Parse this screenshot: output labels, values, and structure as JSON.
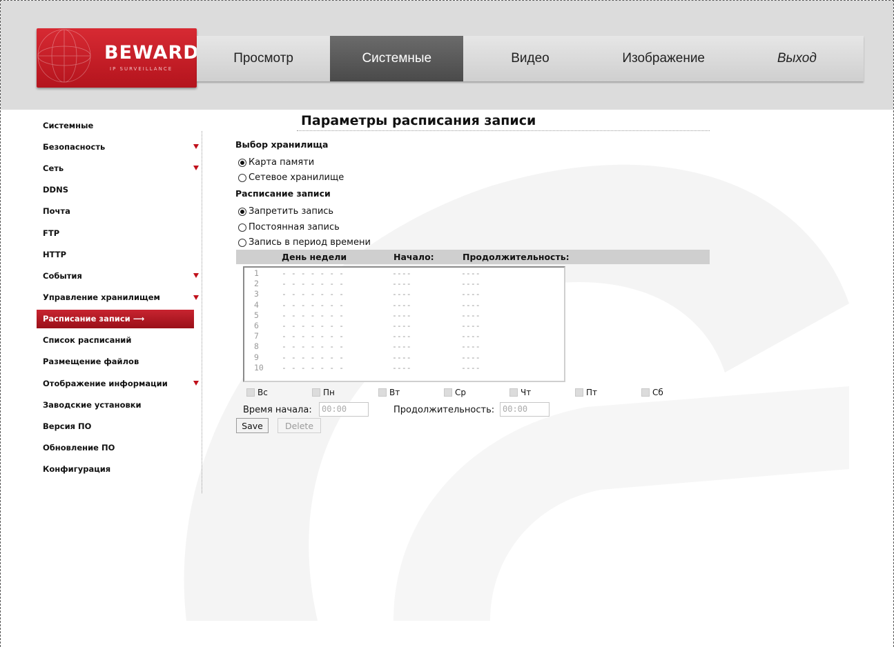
{
  "logo": {
    "text": "BEWARD",
    "sub": "IP SURVEILLANCE"
  },
  "topnav": [
    {
      "label": "Просмотр",
      "active": false
    },
    {
      "label": "Системные",
      "active": true
    },
    {
      "label": "Видео",
      "active": false
    },
    {
      "label": "Изображение",
      "active": false
    },
    {
      "label": "Выход",
      "active": false
    }
  ],
  "sidebar": [
    {
      "label": "Системные",
      "arrow": false
    },
    {
      "label": "Безопасность",
      "arrow": true
    },
    {
      "label": "Сеть",
      "arrow": true
    },
    {
      "label": "DDNS",
      "arrow": false
    },
    {
      "label": "Почта",
      "arrow": false
    },
    {
      "label": "FTP",
      "arrow": false
    },
    {
      "label": "HTTP",
      "arrow": false
    },
    {
      "label": "События",
      "arrow": true
    },
    {
      "label": "Управление хранилищем",
      "arrow": true
    },
    {
      "label": "Расписание записи ⟶",
      "arrow": false,
      "active": true
    },
    {
      "label": "Список расписаний",
      "arrow": false
    },
    {
      "label": "Размещение файлов",
      "arrow": false
    },
    {
      "label": "Отображение информации",
      "arrow": true
    },
    {
      "label": "Заводские установки",
      "arrow": false
    },
    {
      "label": "Версия ПО",
      "arrow": false
    },
    {
      "label": "Обновление ПО",
      "arrow": false
    },
    {
      "label": "Конфигурация",
      "arrow": false
    }
  ],
  "page": {
    "title": "Параметры расписания записи",
    "storage_heading": "Выбор хранилища",
    "storage_options": [
      {
        "label": "Карта памяти",
        "checked": true
      },
      {
        "label": "Сетевое хранилище",
        "checked": false
      }
    ],
    "schedule_heading": "Расписание записи",
    "schedule_options": [
      {
        "label": "Запретить запись",
        "checked": true
      },
      {
        "label": "Постоянная запись",
        "checked": false
      },
      {
        "label": "Запись в период времени",
        "checked": false
      }
    ],
    "columns": {
      "day": "День недели",
      "start": "Начало:",
      "duration": "Продолжительность:"
    },
    "rows": [
      {
        "n": "1",
        "days": "- - - - - - -",
        "start": "----",
        "duration": "----"
      },
      {
        "n": "2",
        "days": "- - - - - - -",
        "start": "----",
        "duration": "----"
      },
      {
        "n": "3",
        "days": "- - - - - - -",
        "start": "----",
        "duration": "----"
      },
      {
        "n": "4",
        "days": "- - - - - - -",
        "start": "----",
        "duration": "----"
      },
      {
        "n": "5",
        "days": "- - - - - - -",
        "start": "----",
        "duration": "----"
      },
      {
        "n": "6",
        "days": "- - - - - - -",
        "start": "----",
        "duration": "----"
      },
      {
        "n": "7",
        "days": "- - - - - - -",
        "start": "----",
        "duration": "----"
      },
      {
        "n": "8",
        "days": "- - - - - - -",
        "start": "----",
        "duration": "----"
      },
      {
        "n": "9",
        "days": "- - - - - - -",
        "start": "----",
        "duration": "----"
      },
      {
        "n": "10",
        "days": "- - - - - - -",
        "start": "----",
        "duration": "----"
      }
    ],
    "weekdays": [
      "Вс",
      "Пн",
      "Вт",
      "Ср",
      "Чт",
      "Пт",
      "Сб"
    ],
    "start_label": "Время начала:",
    "start_value": "00:00",
    "duration_label": "Продолжительность:",
    "duration_value": "00:00",
    "save_label": "Save",
    "delete_label": "Delete"
  },
  "colors": {
    "accent_red": "#c0101b",
    "active_tab": "#555555",
    "header_band": "#dcdcdc"
  }
}
